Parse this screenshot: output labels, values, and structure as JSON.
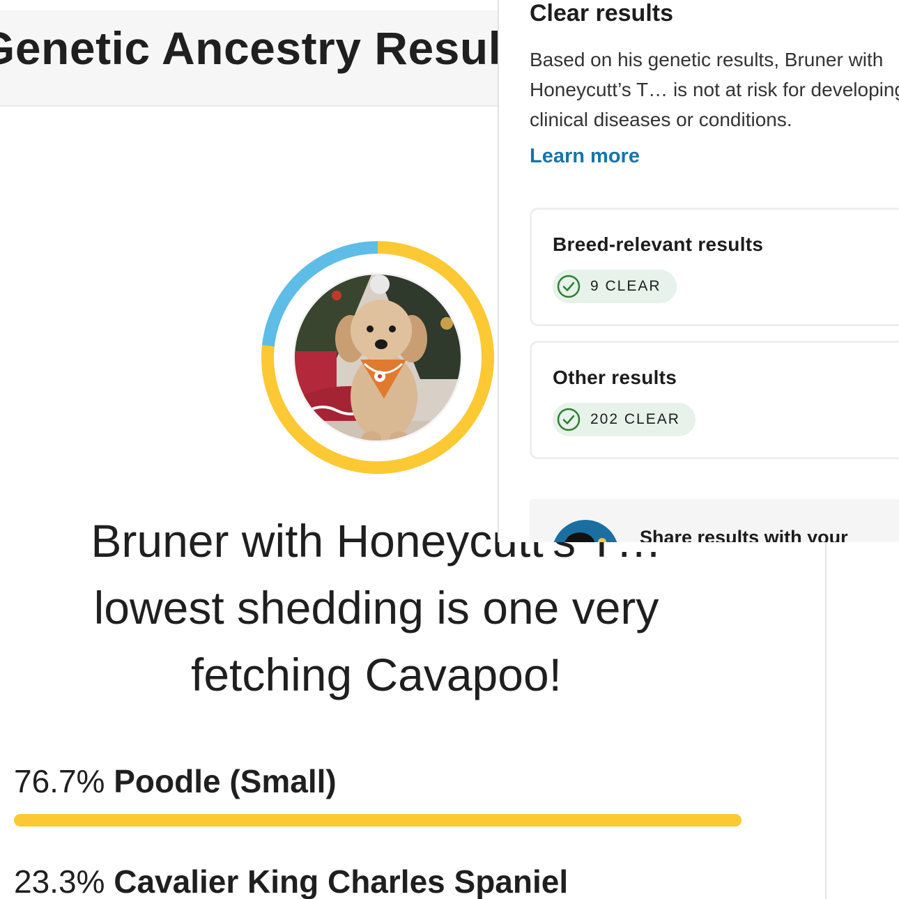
{
  "ancestry": {
    "title": "Genetic Ancestry Results",
    "headline_line1": "Bruner with Honeycutt’s T…",
    "headline_line2": "lowest shedding is one very",
    "headline_line3": "fetching Cavapoo!",
    "breeds": [
      {
        "percent": "76.7%",
        "name": "Poodle (Small)",
        "fraction": 0.767,
        "color": "#fcc934"
      },
      {
        "percent": "23.3%",
        "name": "Cavalier King Charles Spaniel",
        "fraction": 0.233,
        "color": "#5dbde6"
      }
    ],
    "bar_color": "#fcc934"
  },
  "clear_results": {
    "heading": "Clear results",
    "description_lines": [
      "Based on his genetic results, Bruner with",
      "Honeycutt’s T… is not at risk for developing",
      "clinical diseases or conditions."
    ],
    "learn_more": "Learn more",
    "cards": [
      {
        "title": "Breed-relevant results",
        "badge": "9 CLEAR"
      },
      {
        "title": "Other results",
        "badge": "202 CLEAR"
      }
    ],
    "share_text": "Share results with your",
    "accent_color": "#1774a8",
    "clear_color": "#2e7d32"
  }
}
